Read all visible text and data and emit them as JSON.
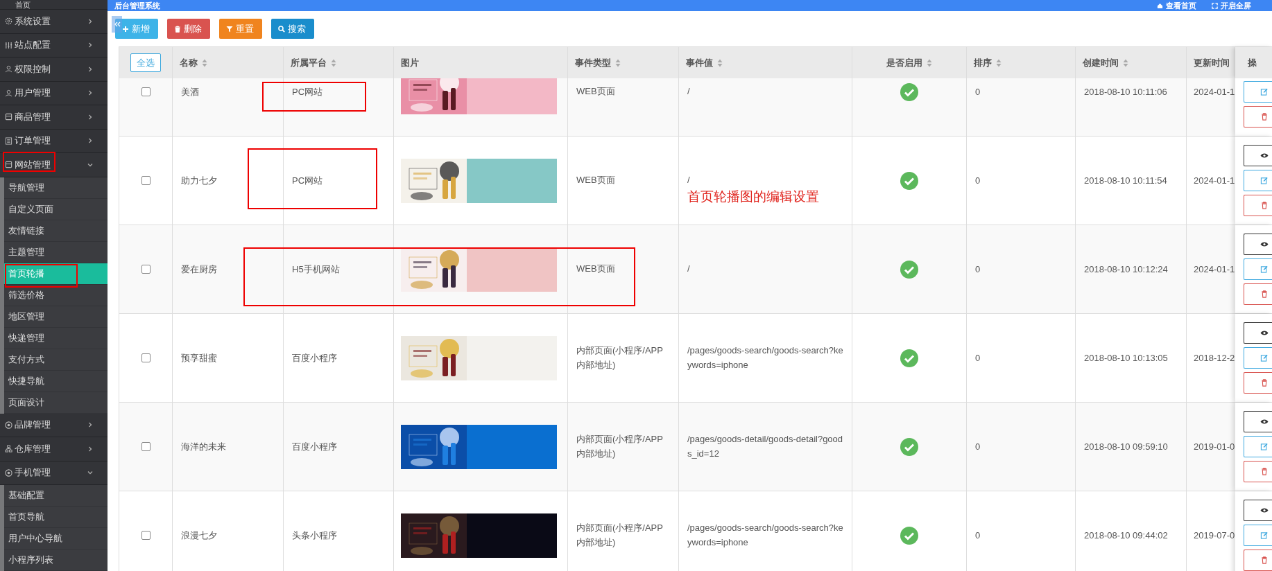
{
  "header": {
    "title": "后台管理系统",
    "links": [
      {
        "kind": "home",
        "label": "查看首页"
      },
      {
        "kind": "fullscreen",
        "label": "开启全屏"
      }
    ]
  },
  "sidebar": {
    "items": [
      {
        "label": "首页",
        "kind": "link"
      },
      {
        "label": "系统设置",
        "kind": "menu",
        "expanded": false
      },
      {
        "label": "站点配置",
        "kind": "menu",
        "expanded": false
      },
      {
        "label": "权限控制",
        "kind": "menu",
        "expanded": false
      },
      {
        "label": "用户管理",
        "kind": "menu",
        "expanded": false
      },
      {
        "label": "商品管理",
        "kind": "menu",
        "expanded": false
      },
      {
        "label": "订单管理",
        "kind": "menu",
        "expanded": false
      },
      {
        "label": "网站管理",
        "kind": "menu",
        "expanded": true,
        "children": [
          {
            "label": "导航管理",
            "selected": false
          },
          {
            "label": "自定义页面",
            "selected": false
          },
          {
            "label": "友情链接",
            "selected": false
          },
          {
            "label": "主题管理",
            "selected": false
          },
          {
            "label": "首页轮播",
            "selected": true
          },
          {
            "label": "筛选价格",
            "selected": false
          },
          {
            "label": "地区管理",
            "selected": false
          },
          {
            "label": "快递管理",
            "selected": false
          },
          {
            "label": "支付方式",
            "selected": false
          },
          {
            "label": "快捷导航",
            "selected": false
          },
          {
            "label": "页面设计",
            "selected": false
          }
        ]
      },
      {
        "label": "品牌管理",
        "kind": "menu",
        "expanded": false
      },
      {
        "label": "仓库管理",
        "kind": "menu",
        "expanded": false
      },
      {
        "label": "手机管理",
        "kind": "menu",
        "expanded": true,
        "children": [
          {
            "label": "基础配置",
            "selected": false
          },
          {
            "label": "首页导航",
            "selected": false
          },
          {
            "label": "用户中心导航",
            "selected": false
          },
          {
            "label": "小程序列表",
            "selected": false
          }
        ]
      }
    ]
  },
  "toolbar": {
    "buttons": [
      {
        "kind": "add",
        "label": "新增"
      },
      {
        "kind": "delete",
        "label": "删除"
      },
      {
        "kind": "reset",
        "label": "重置"
      },
      {
        "kind": "search",
        "label": "搜索"
      }
    ]
  },
  "table": {
    "select_all": "全选",
    "columns": [
      {
        "label": "名称",
        "sortable": true
      },
      {
        "label": "所属平台",
        "sortable": true
      },
      {
        "label": "图片",
        "sortable": false
      },
      {
        "label": "事件类型",
        "sortable": true
      },
      {
        "label": "事件值",
        "sortable": true
      },
      {
        "label": "是否启用",
        "sortable": true
      },
      {
        "label": "排序",
        "sortable": true
      },
      {
        "label": "创建时间",
        "sortable": true
      },
      {
        "label": "更新时间",
        "sortable": false
      },
      {
        "label": "操",
        "sortable": false
      }
    ],
    "rows": [
      {
        "checked": false,
        "name": "美酒",
        "platform": "PC网站",
        "event_type": "WEB页面",
        "event_value": "/",
        "enabled": true,
        "sort": "0",
        "created": "2018-08-10 10:11:06",
        "updated": "2024-01-1",
        "actions": [
          {
            "kind": "edit"
          },
          {
            "kind": "delete"
          }
        ]
      },
      {
        "checked": false,
        "name": "助力七夕",
        "platform": "PC网站",
        "event_type": "WEB页面",
        "event_value": "/",
        "note": "首页轮播图的编辑设置",
        "enabled": true,
        "sort": "0",
        "created": "2018-08-10 10:11:54",
        "updated": "2024-01-1",
        "actions": [
          {
            "kind": "view"
          },
          {
            "kind": "edit"
          },
          {
            "kind": "delete"
          }
        ]
      },
      {
        "checked": false,
        "name": "爱在厨房",
        "platform": "H5手机网站",
        "event_type": "WEB页面",
        "event_value": "/",
        "enabled": true,
        "sort": "0",
        "created": "2018-08-10 10:12:24",
        "updated": "2024-01-1",
        "actions": [
          {
            "kind": "view"
          },
          {
            "kind": "edit"
          },
          {
            "kind": "delete"
          }
        ]
      },
      {
        "checked": false,
        "name": "预享甜蜜",
        "platform": "百度小程序",
        "event_type": "内部页面(小程序/APP内部地址)",
        "event_value": "/pages/goods-search/goods-search?keywords=iphone",
        "enabled": true,
        "sort": "0",
        "created": "2018-08-10 10:13:05",
        "updated": "2018-12-2",
        "actions": [
          {
            "kind": "view"
          },
          {
            "kind": "edit"
          },
          {
            "kind": "delete"
          }
        ]
      },
      {
        "checked": false,
        "name": "海洋的未来",
        "platform": "百度小程序",
        "event_type": "内部页面(小程序/APP内部地址)",
        "event_value": "/pages/goods-detail/goods-detail?goods_id=12",
        "enabled": true,
        "sort": "0",
        "created": "2018-08-10 09:59:10",
        "updated": "2019-01-0",
        "actions": [
          {
            "kind": "view"
          },
          {
            "kind": "edit"
          },
          {
            "kind": "delete"
          }
        ]
      },
      {
        "checked": false,
        "name": "浪漫七夕",
        "platform": "头条小程序",
        "event_type": "内部页面(小程序/APP内部地址)",
        "event_value": "/pages/goods-search/goods-search?keywords=iphone",
        "enabled": true,
        "sort": "0",
        "created": "2018-08-10 09:44:02",
        "updated": "2019-07-0",
        "actions": [
          {
            "kind": "view"
          },
          {
            "kind": "edit"
          },
          {
            "kind": "delete"
          }
        ]
      }
    ]
  }
}
